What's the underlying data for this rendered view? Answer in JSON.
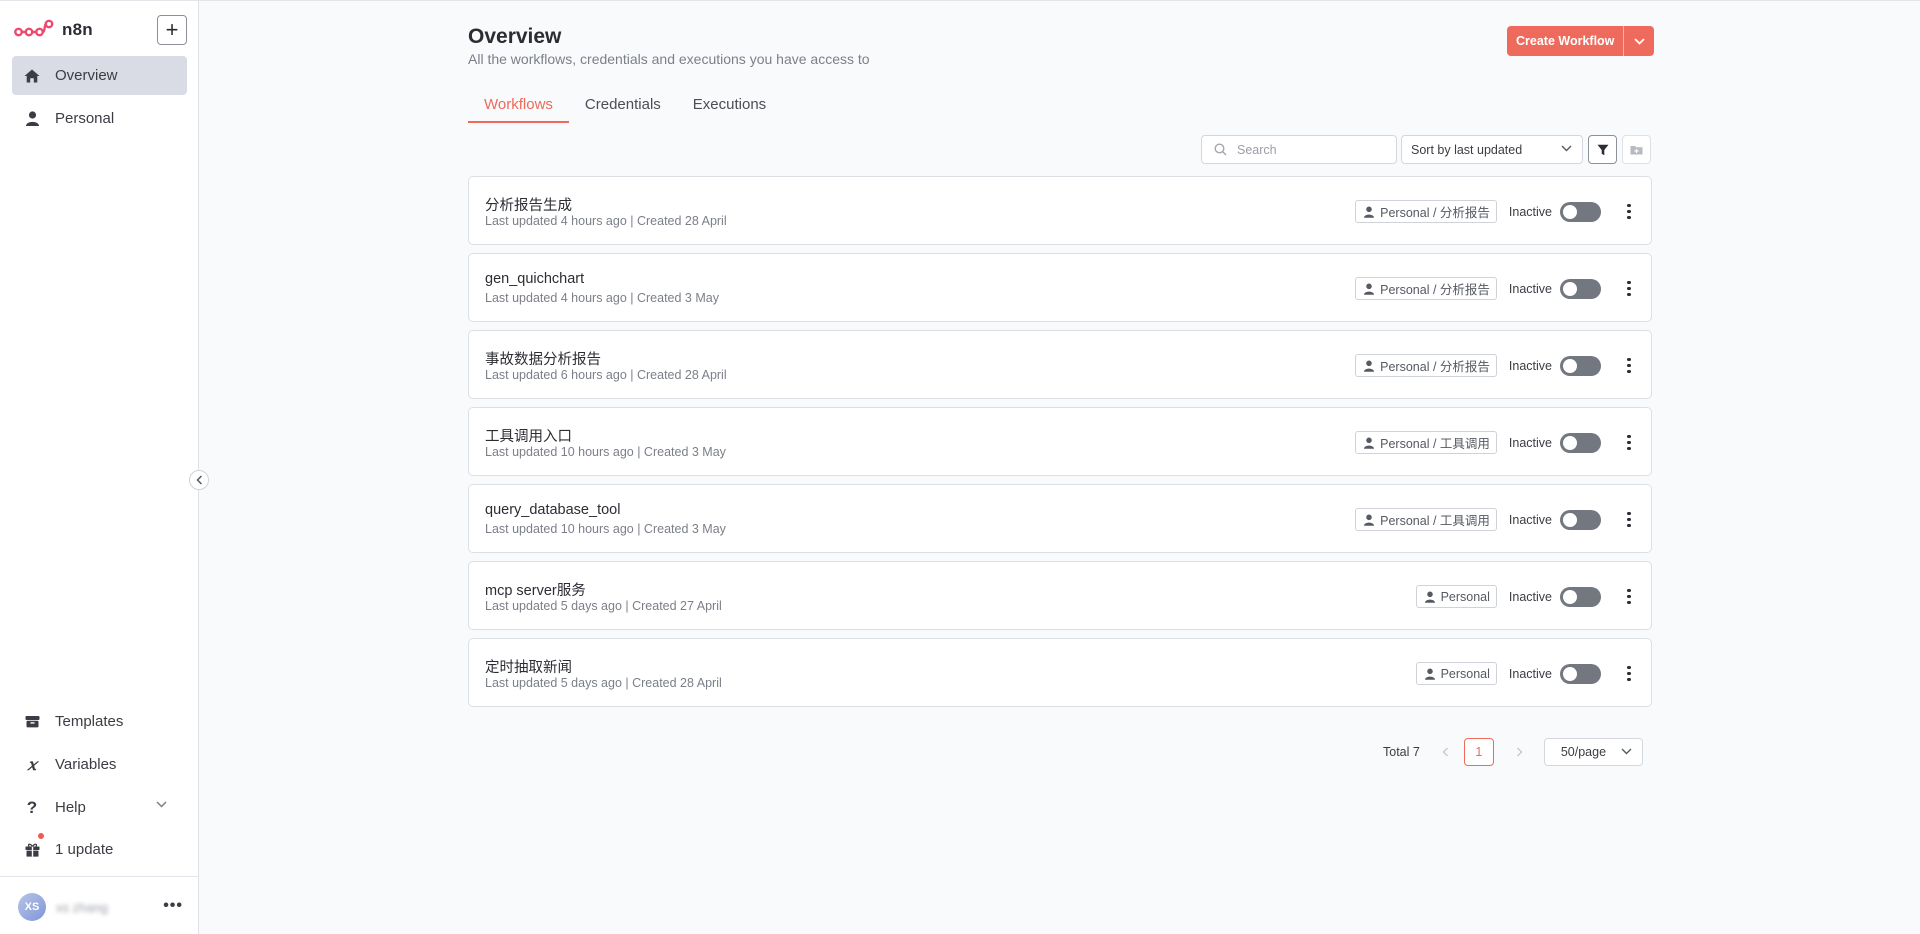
{
  "app": {
    "name": "n8n",
    "brand_color": "#ee6a5c"
  },
  "sidebar": {
    "add_label": "+",
    "nav": [
      {
        "label": "Overview",
        "icon": "home-icon"
      },
      {
        "label": "Personal",
        "icon": "user-icon"
      }
    ],
    "bottom": [
      {
        "label": "Templates",
        "icon": "box-icon"
      },
      {
        "label": "Variables",
        "icon": "variable-icon"
      },
      {
        "label": "Help",
        "icon": "question-icon"
      },
      {
        "label": "1 update",
        "icon": "gift-icon"
      }
    ],
    "user": {
      "initials": "XS",
      "name": "xs zhang",
      "menu": "•••"
    }
  },
  "header": {
    "title": "Overview",
    "subtitle": "All the workflows, credentials and executions you have access to",
    "create_label": "Create Workflow"
  },
  "tabs": [
    {
      "label": "Workflows",
      "active": true
    },
    {
      "label": "Credentials",
      "active": false
    },
    {
      "label": "Executions",
      "active": false
    }
  ],
  "toolbar": {
    "search_placeholder": "Search",
    "sort_value": "Sort by last updated"
  },
  "workflows": [
    {
      "name": "分析报告生成",
      "meta": "Last updated 4 hours ago | Created 28 April",
      "project": "Personal / 分析报告",
      "status": "Inactive"
    },
    {
      "name": "gen_quichchart",
      "meta": "Last updated 4 hours ago | Created 3 May",
      "project": "Personal / 分析报告",
      "status": "Inactive"
    },
    {
      "name": "事故数据分析报告",
      "meta": "Last updated 6 hours ago | Created 28 April",
      "project": "Personal / 分析报告",
      "status": "Inactive"
    },
    {
      "name": "工具调用入口",
      "meta": "Last updated 10 hours ago | Created 3 May",
      "project": "Personal / 工具调用",
      "status": "Inactive"
    },
    {
      "name": "query_database_tool",
      "meta": "Last updated 10 hours ago | Created 3 May",
      "project": "Personal / 工具调用",
      "status": "Inactive"
    },
    {
      "name": "mcp server服务",
      "meta": "Last updated 5 days ago | Created 27 April",
      "project": "Personal",
      "status": "Inactive"
    },
    {
      "name": "定时抽取新闻",
      "meta": "Last updated 5 days ago | Created 28 April",
      "project": "Personal",
      "status": "Inactive"
    }
  ],
  "pagination": {
    "total": "Total 7",
    "current": "1",
    "per_page": "50/page"
  }
}
